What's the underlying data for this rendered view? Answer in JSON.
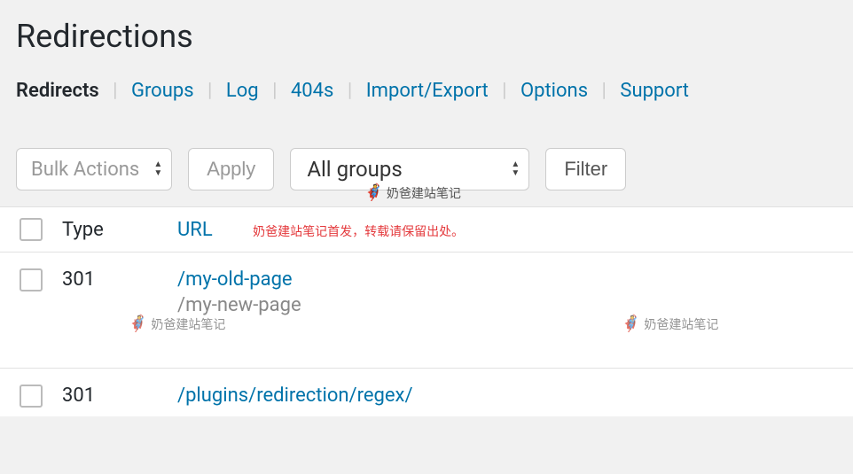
{
  "page": {
    "title": "Redirections"
  },
  "tabs": {
    "redirects": "Redirects",
    "groups": "Groups",
    "log": "Log",
    "n404": "404s",
    "import": "Import/Export",
    "options": "Options",
    "support": "Support"
  },
  "toolbar": {
    "bulk": "Bulk Actions",
    "apply": "Apply",
    "groups": "All groups",
    "filter": "Filter"
  },
  "table": {
    "header_type": "Type",
    "header_url": "URL",
    "notice": "奶爸建站笔记首发，转载请保留出处。",
    "rows": [
      {
        "type": "301",
        "source": "/my-old-page",
        "target": "/my-new-page"
      },
      {
        "type": "301",
        "source": "/plugins/redirection/regex/",
        "target": ""
      }
    ]
  },
  "watermark": {
    "text": "奶爸建站笔记"
  }
}
